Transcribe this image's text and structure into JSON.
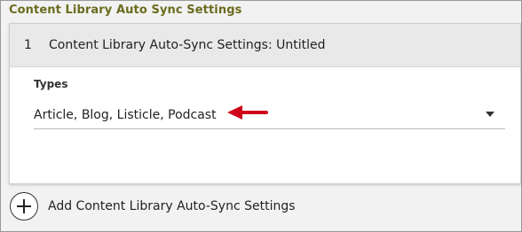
{
  "section": {
    "title": "Content Library Auto Sync Settings"
  },
  "card": {
    "index": "1",
    "title": "Content Library Auto-Sync Settings: Untitled"
  },
  "types_field": {
    "label": "Types",
    "value": "Article, Blog, Listicle, Podcast"
  },
  "add_button": {
    "label": "Add Content Library Auto-Sync Settings"
  },
  "colors": {
    "section_title": "#6b6b1f",
    "header_bg": "#e9e9e9",
    "arrow": "#d0021b"
  },
  "icons": [
    "dropdown-caret-icon",
    "red-arrow-annotation-icon",
    "plus-icon"
  ]
}
